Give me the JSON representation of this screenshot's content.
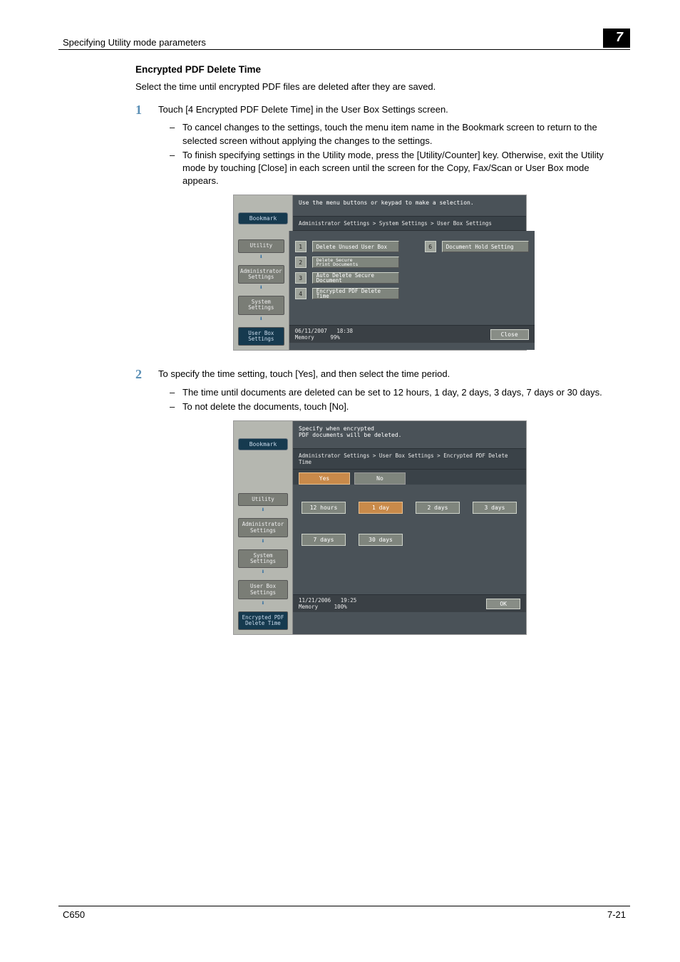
{
  "header": {
    "section_title": "Specifying Utility mode parameters",
    "chapter": "7"
  },
  "title": "Encrypted PDF Delete Time",
  "intro": "Select the time until encrypted PDF files are deleted after they are saved.",
  "step1": {
    "num": "1",
    "text": "Touch [4 Encrypted PDF Delete Time] in the User Box Settings screen.",
    "bullets": [
      "To cancel changes to the settings, touch the menu item name in the Bookmark screen to return to the selected screen without applying the changes to the settings.",
      "To finish specifying settings in the Utility mode, press the [Utility/Counter] key. Otherwise, exit the Utility mode by touching [Close] in each screen until the screen for the Copy, Fax/Scan or User Box mode appears."
    ]
  },
  "screenshot1": {
    "instruction": "Use the menu buttons or keypad to make a selection.",
    "breadcrumb": "Administrator Settings > System Settings > User Box Settings",
    "bookmark": "Bookmark",
    "nav": [
      "Utility",
      "Administrator Settings",
      "System Settings",
      "User Box Settings"
    ],
    "nav_active_index": 3,
    "menu": [
      {
        "n": "1",
        "label": "Delete Unused User Box"
      },
      {
        "n": "2",
        "label_l1": "Delete Secure",
        "label_l2": "Print Documents"
      },
      {
        "n": "3",
        "label": "Auto Delete Secure Document"
      },
      {
        "n": "4",
        "label": "Encrypted PDF Delete Time"
      }
    ],
    "menu_right": [
      {
        "n": "6",
        "label": "Document Hold Setting"
      }
    ],
    "status": {
      "date": "06/11/2007",
      "time": "18:38",
      "mem_label": "Memory",
      "mem_val": "99%"
    },
    "close": "Close"
  },
  "step2": {
    "num": "2",
    "text": "To specify the time setting, touch [Yes], and then select the time period.",
    "bullets": [
      "The time until documents are deleted can be set to 12 hours, 1 day, 2 days, 3 days, 7 days or 30 days.",
      "To not delete the documents, touch [No]."
    ]
  },
  "screenshot2": {
    "instr_l1": "Specify when encrypted",
    "instr_l2": "PDF documents will be deleted.",
    "breadcrumb": "Administrator Settings > User Box Settings > Encrypted PDF Delete Time",
    "bookmark": "Bookmark",
    "nav": [
      "Utility",
      "Administrator Settings",
      "System Settings",
      "User Box Settings",
      "Encrypted PDF Delete Time"
    ],
    "nav_active_index": 4,
    "yes": "Yes",
    "no": "No",
    "times_row1": [
      "12 hours",
      "1 day",
      "2 days",
      "3 days"
    ],
    "times_row2": [
      "7 days",
      "30 days"
    ],
    "selected_time": "1 day",
    "status": {
      "date": "11/21/2006",
      "time": "19:25",
      "mem_label": "Memory",
      "mem_val": "100%"
    },
    "ok": "OK"
  },
  "footer": {
    "left": "C650",
    "right": "7-21"
  }
}
